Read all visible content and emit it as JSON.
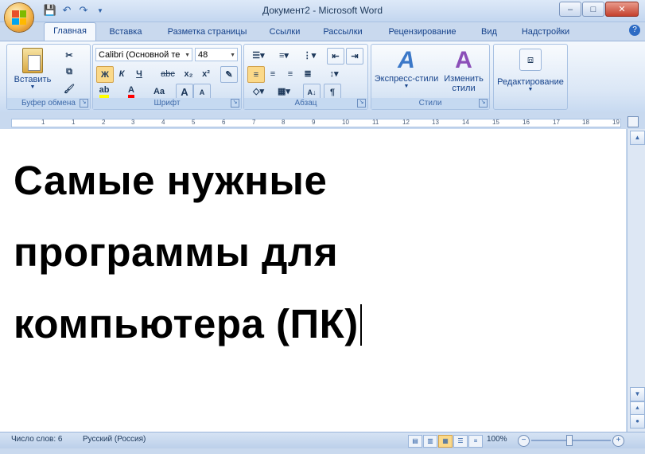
{
  "window": {
    "title": "Документ2 - Microsoft Word",
    "minimize_glyph": "–",
    "maximize_glyph": "□",
    "close_glyph": "✕"
  },
  "qat": {
    "save_icon": "save-icon",
    "undo_icon": "undo-icon",
    "redo_icon": "redo-icon",
    "customize_icon": "chevron-down-icon"
  },
  "tabs": [
    "Главная",
    "Вставка",
    "Разметка страницы",
    "Ссылки",
    "Рассылки",
    "Рецензирование",
    "Вид",
    "Надстройки"
  ],
  "help_glyph": "?",
  "ribbon": {
    "clipboard": {
      "paste_label": "Вставить",
      "group_label": "Буфер обмена"
    },
    "font": {
      "font_name": "Calibri (Основной те",
      "font_size": "48",
      "bold": "Ж",
      "italic": "К",
      "underline": "Ч",
      "strike": "abc",
      "subscript": "x₂",
      "superscript": "x²",
      "grow": "A",
      "shrink": "A",
      "case": "Aa",
      "group_label": "Шрифт"
    },
    "paragraph": {
      "sort": "A↓",
      "marks": "¶",
      "group_label": "Абзац"
    },
    "styles": {
      "express_label": "Экспресс-стили",
      "change_label": "Изменить стили",
      "group_label": "Стили"
    },
    "editing": {
      "label": "Редактирование"
    }
  },
  "ruler": {
    "numbers": [
      "1",
      "1",
      "2",
      "3",
      "4",
      "5",
      "6",
      "7",
      "8",
      "9",
      "10",
      "11",
      "12",
      "13",
      "14",
      "15",
      "16",
      "17",
      "18",
      "19"
    ]
  },
  "document": {
    "line1": "Самые нужные",
    "line2": "программы для",
    "line3": "компьютера (ПК)"
  },
  "status": {
    "word_count": "Число слов: 6",
    "language": "Русский (Россия)",
    "zoom": "100%",
    "zoom_out": "−",
    "zoom_in": "+"
  },
  "colors": {
    "highlight": "#ffff00",
    "font_color": "#ff0000",
    "accent": "#15428b"
  }
}
